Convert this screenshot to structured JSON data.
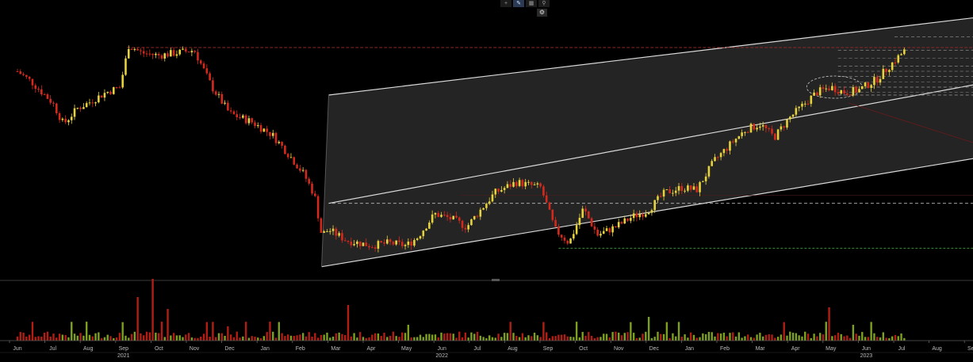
{
  "toolbar": {
    "icons": [
      "crosshair-icon",
      "pencil-icon",
      "chart-icon",
      "magnifier-icon"
    ],
    "settings_icon": "gear-icon"
  },
  "chart_data": {
    "type": "candlestick",
    "colors": {
      "up": "#e6d23c",
      "down": "#d42a1e",
      "vol_up": "#7da020",
      "vol_down": "#b01e14",
      "channel_fill": "#262626",
      "line": "#d9d9d9",
      "ref_red": "#8a2a2a",
      "ref_green": "#3c8c3c"
    },
    "x_axis": {
      "month_labels": [
        {
          "label": "Jun",
          "t": 0.0
        },
        {
          "label": "Jul",
          "t": 1.0
        },
        {
          "label": "Aug",
          "t": 2.0
        },
        {
          "label": "Sep",
          "t": 3.0
        },
        {
          "label": "Oct",
          "t": 4.0
        },
        {
          "label": "Nov",
          "t": 5.0
        },
        {
          "label": "Dec",
          "t": 6.0
        },
        {
          "label": "Jan",
          "t": 7.0
        },
        {
          "label": "Feb",
          "t": 8.0
        },
        {
          "label": "Mar",
          "t": 9.0
        },
        {
          "label": "Apr",
          "t": 10.0
        },
        {
          "label": "May",
          "t": 11.0
        },
        {
          "label": "Jun",
          "t": 12.0
        },
        {
          "label": "Jul",
          "t": 13.0
        },
        {
          "label": "Aug",
          "t": 14.0
        },
        {
          "label": "Sep",
          "t": 15.0
        },
        {
          "label": "Oct",
          "t": 16.0
        },
        {
          "label": "Nov",
          "t": 17.0
        },
        {
          "label": "Dec",
          "t": 18.0
        },
        {
          "label": "Jan",
          "t": 19.0
        },
        {
          "label": "Feb",
          "t": 20.0
        },
        {
          "label": "Mar",
          "t": 21.0
        },
        {
          "label": "Apr",
          "t": 22.0
        },
        {
          "label": "May",
          "t": 23.0
        },
        {
          "label": "Jun",
          "t": 24.0
        },
        {
          "label": "Jul",
          "t": 25.0
        },
        {
          "label": "Aug",
          "t": 26.0
        },
        {
          "label": "Sep",
          "t": 27.0
        }
      ],
      "year_labels": [
        {
          "label": "2021",
          "t": 3.0
        },
        {
          "label": "2022",
          "t": 12.0
        },
        {
          "label": "2023",
          "t": 24.0
        }
      ]
    },
    "price_path": [
      [
        0.0,
        72
      ],
      [
        0.4,
        68
      ],
      [
        1.0,
        60
      ],
      [
        1.3,
        52
      ],
      [
        1.7,
        58
      ],
      [
        2.0,
        60
      ],
      [
        2.5,
        64
      ],
      [
        2.9,
        66
      ],
      [
        3.15,
        82
      ],
      [
        3.5,
        79
      ],
      [
        4.0,
        78
      ],
      [
        4.5,
        79
      ],
      [
        5.0,
        80
      ],
      [
        5.5,
        66
      ],
      [
        6.0,
        56
      ],
      [
        6.6,
        53
      ],
      [
        7.2,
        48
      ],
      [
        7.7,
        40
      ],
      [
        8.1,
        33
      ],
      [
        8.4,
        25
      ],
      [
        8.6,
        10
      ],
      [
        8.8,
        12
      ],
      [
        9.3,
        8
      ],
      [
        10.0,
        6
      ],
      [
        10.5,
        7
      ],
      [
        11.0,
        6
      ],
      [
        11.3,
        9
      ],
      [
        11.8,
        18
      ],
      [
        12.3,
        16
      ],
      [
        12.7,
        13
      ],
      [
        13.0,
        18
      ],
      [
        13.5,
        26
      ],
      [
        14.1,
        30
      ],
      [
        14.8,
        28
      ],
      [
        15.2,
        12
      ],
      [
        15.6,
        7
      ],
      [
        16.0,
        20
      ],
      [
        16.4,
        10
      ],
      [
        16.9,
        13
      ],
      [
        17.4,
        17
      ],
      [
        17.8,
        19
      ],
      [
        18.3,
        26
      ],
      [
        18.8,
        28
      ],
      [
        19.2,
        27
      ],
      [
        19.7,
        38
      ],
      [
        20.2,
        45
      ],
      [
        20.6,
        50
      ],
      [
        21.0,
        52
      ],
      [
        21.4,
        47
      ],
      [
        21.8,
        54
      ],
      [
        22.2,
        59
      ],
      [
        22.6,
        64
      ],
      [
        23.0,
        66
      ],
      [
        23.4,
        64
      ],
      [
        23.8,
        65
      ],
      [
        24.3,
        69
      ],
      [
        24.8,
        76
      ],
      [
        25.1,
        80
      ]
    ],
    "reference_lines": {
      "resistance_red": 81,
      "resistance_red_2": 75,
      "channel_top_dashed": 22,
      "support_green": 5,
      "right_stack": [
        80,
        77,
        74,
        72,
        70,
        68,
        66,
        64,
        63
      ]
    }
  }
}
